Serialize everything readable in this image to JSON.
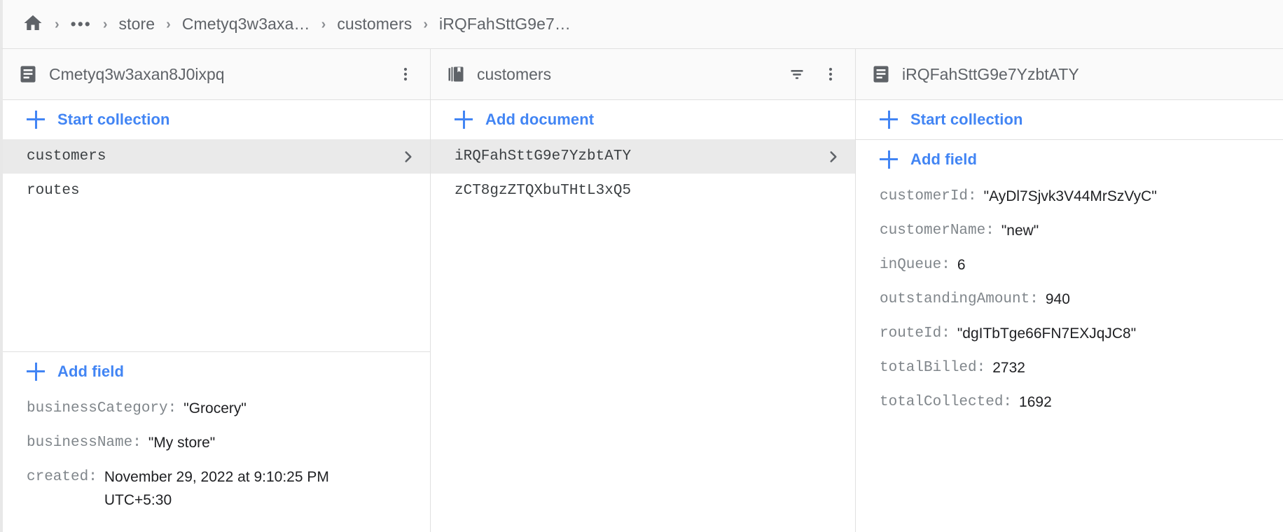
{
  "breadcrumb": {
    "home_icon": "home-icon",
    "separator": "›",
    "ellipsis": "•••",
    "items": [
      {
        "label": "store"
      },
      {
        "label": "Cmetyq3w3axa…"
      },
      {
        "label": "customers"
      },
      {
        "label": "iRQFahSttG9e7…"
      }
    ]
  },
  "colors": {
    "accent": "#4285f4",
    "header_bg": "#fafafa",
    "selected_bg": "#eaeaea",
    "text_primary": "#202124",
    "text_secondary": "#5f6368",
    "key_gray": "#80868b",
    "border": "#e0e0e0"
  },
  "panels": {
    "document_panel": {
      "icon": "document-icon",
      "title": "Cmetyq3w3axan8J0ixpq",
      "more_icon": "more-vert-icon",
      "start_collection_label": "Start collection",
      "collections": [
        {
          "label": "customers",
          "selected": true
        },
        {
          "label": "routes",
          "selected": false
        }
      ],
      "add_field_label": "Add field",
      "fields": [
        {
          "key": "businessCategory:",
          "value": "\"Grocery\"",
          "wrapped": false
        },
        {
          "key": "businessName:",
          "value": "\"My store\"",
          "wrapped": false
        },
        {
          "key": "created:",
          "value": "November 29, 2022 at 9:10:25 PM UTC+5:30",
          "wrapped": true
        }
      ]
    },
    "collection_panel": {
      "icon": "collection-icon",
      "title": "customers",
      "filter_icon": "filter-icon",
      "more_icon": "more-vert-icon",
      "add_document_label": "Add document",
      "documents": [
        {
          "label": "iRQFahSttG9e7YzbtATY",
          "selected": true
        },
        {
          "label": "zCT8gzZTQXbuTHtL3xQ5",
          "selected": false
        }
      ]
    },
    "detail_panel": {
      "icon": "document-icon",
      "title": "iRQFahSttG9e7YzbtATY",
      "start_collection_label": "Start collection",
      "add_field_label": "Add field",
      "fields": [
        {
          "key": "customerId:",
          "value": "\"AyDl7Sjvk3V44MrSzVyC\""
        },
        {
          "key": "customerName:",
          "value": "\"new\""
        },
        {
          "key": "inQueue:",
          "value": "6"
        },
        {
          "key": "outstandingAmount:",
          "value": "940"
        },
        {
          "key": "routeId:",
          "value": "\"dgITbTge66FN7EXJqJC8\""
        },
        {
          "key": "totalBilled:",
          "value": "2732"
        },
        {
          "key": "totalCollected:",
          "value": "1692"
        }
      ]
    }
  }
}
